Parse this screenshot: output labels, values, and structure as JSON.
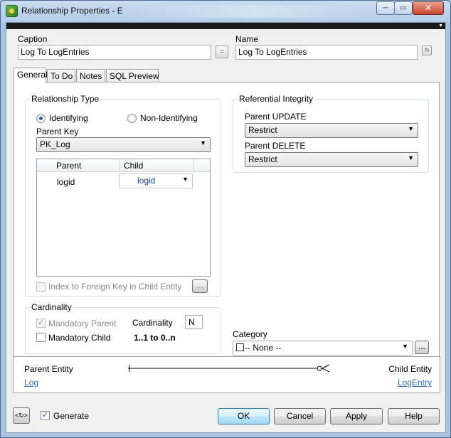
{
  "window": {
    "title": "Relationship Properties - E",
    "minimize_glyph": "─",
    "maximize_glyph": "▭",
    "close_glyph": "✕"
  },
  "form": {
    "caption_label": "Caption",
    "caption_value": "Log To LogEntries",
    "equals_button": "=",
    "name_label": "Name",
    "name_value": "Log To LogEntries",
    "name_button": "N"
  },
  "tabs": [
    "General",
    "To Do",
    "Notes",
    "SQL Preview"
  ],
  "relationship_type": {
    "title": "Relationship Type",
    "identifying": "Identifying",
    "non_identifying": "Non-Identifying",
    "parent_key_label": "Parent Key",
    "parent_key_value": "PK_Log",
    "grid_headers": [
      "Parent",
      "Child"
    ],
    "rows": [
      {
        "parent": "logid",
        "child": "logid"
      }
    ],
    "index_checkbox": "Index to Foreign Key in Child Entity",
    "ellipsis": "..."
  },
  "referential_integrity": {
    "title": "Referential Integrity",
    "update_label": "Parent UPDATE",
    "update_value": "Restrict",
    "delete_label": "Parent DELETE",
    "delete_value": "Restrict"
  },
  "cardinality": {
    "title": "Cardinality",
    "mandatory_parent": "Mandatory Parent",
    "mandatory_parent_checked": true,
    "mandatory_child": "Mandatory Child",
    "cardinality_label": "Cardinality",
    "cardinality_value": "N",
    "cardinality_text": "1..1 to 0..n"
  },
  "category": {
    "label": "Category",
    "value": "-- None --",
    "ellipsis": "..."
  },
  "entities": {
    "parent_label": "Parent Entity",
    "parent_link": "Log",
    "child_label": "Child Entity",
    "child_link": "LogEntry"
  },
  "footer": {
    "generate_label": "Generate",
    "generate_checked": true,
    "ok": "OK",
    "cancel": "Cancel",
    "apply": "Apply",
    "help": "Help"
  },
  "colors": {
    "link": "#3a6fb0",
    "accent": "#3c7fb1"
  }
}
